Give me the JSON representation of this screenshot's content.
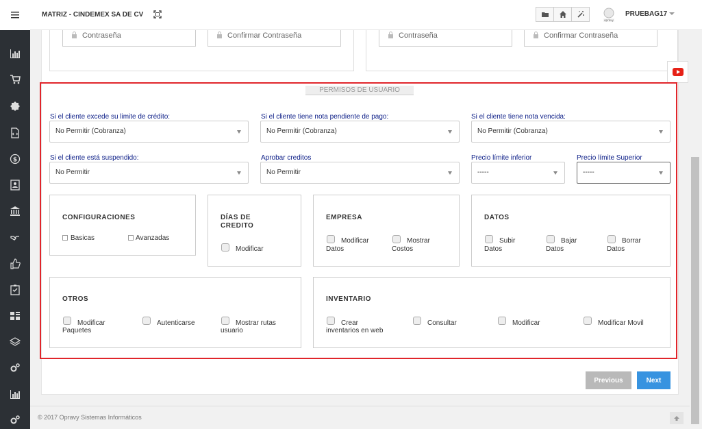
{
  "header": {
    "company": "MATRIZ - CINDEMEX SA DE CV",
    "username": "PRUEBAG17"
  },
  "sidebar": {
    "icons": [
      "menu-icon",
      "bar-chart-icon",
      "cart-icon",
      "gear-badge-icon",
      "file-code-icon",
      "dollar-icon",
      "contact-card-icon",
      "bank-icon",
      "handshake-icon",
      "thumbs-up-icon",
      "checklist-icon",
      "dashboard-icon",
      "layers-icon",
      "cogs-icon",
      "bar-chart-icon",
      "cogs-icon"
    ]
  },
  "credentials": {
    "password_placeholder": "Contraseña",
    "confirm_placeholder": "Confirmar Contraseña"
  },
  "permisos": {
    "title": "PERMISOS DE USUARIO",
    "fields": [
      {
        "label": "Si el cliente excede su limite de crédito:",
        "value": "No Permitir (Cobranza)"
      },
      {
        "label": "Si el cliente tiene nota pendiente de pago:",
        "value": "No Permitir (Cobranza)"
      },
      {
        "label": "Si el cliente tiene nota vencida:",
        "value": "No Permitir (Cobranza)"
      },
      {
        "label": "Si el cliente está suspendido:",
        "value": "No Permitir"
      },
      {
        "label": "Aprobar creditos",
        "value": "No Permitir"
      },
      {
        "label": "Precio límite inferior",
        "value": "-----"
      },
      {
        "label": "Precio límite Superior",
        "value": "-----"
      }
    ],
    "groups": {
      "configuraciones": {
        "title": "CONFIGURACIONES",
        "options": [
          "Basicas",
          "Avanzadas"
        ]
      },
      "dias_credito": {
        "title_line1": "DÍAS DE",
        "title_line2": "CREDITO",
        "options": [
          "Modificar"
        ]
      },
      "empresa": {
        "title": "EMPRESA",
        "options": [
          [
            "Modificar",
            "Datos"
          ],
          [
            "Mostrar",
            "Costos"
          ]
        ]
      },
      "datos": {
        "title": "DATOS",
        "options": [
          [
            "Subir",
            "Datos"
          ],
          [
            "Bajar",
            "Datos"
          ],
          [
            "Borrar",
            "Datos"
          ]
        ]
      },
      "otros": {
        "title": "OTROS",
        "options": [
          [
            "Modificar",
            "Paquetes"
          ],
          [
            "Autenticarse",
            ""
          ],
          [
            "Mostrar rutas",
            "usuario"
          ]
        ]
      },
      "inventario": {
        "title": "INVENTARIO",
        "options": [
          [
            "Crear",
            "inventarios en web"
          ],
          [
            "Consultar",
            ""
          ],
          [
            "Modificar",
            ""
          ],
          [
            "Modificar Movil",
            ""
          ]
        ]
      }
    }
  },
  "nav": {
    "previous": "Previous",
    "next": "Next"
  },
  "footer": {
    "copyright": "© 2017 Opravy Sistemas Informáticos"
  },
  "colors": {
    "highlight_border": "#e0252b",
    "label_blue": "#0a1c86",
    "next_button": "#3793e0",
    "prev_button": "#b9b9b9",
    "sidebar_bg": "#2c3035"
  }
}
